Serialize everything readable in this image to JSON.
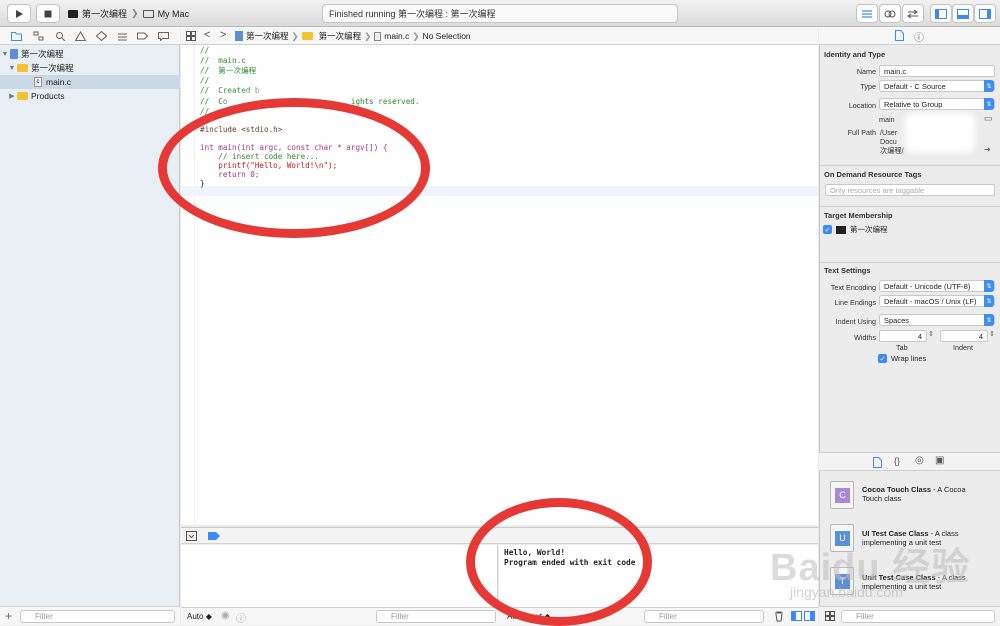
{
  "toolbar": {
    "scheme_target": "第一次编程",
    "scheme_device": "My Mac",
    "activity_text": "Finished running 第一次编程 : 第一次编程"
  },
  "jump_bar": {
    "crumbs": [
      "第一次编程",
      "第一次编程",
      "main.c",
      "No Selection"
    ]
  },
  "navigator": {
    "items": [
      {
        "label": "第一次编程",
        "kind": "project"
      },
      {
        "label": "第一次编程",
        "kind": "folder"
      },
      {
        "label": "main.c",
        "kind": "file",
        "selected": true
      },
      {
        "label": "Products",
        "kind": "folder"
      }
    ],
    "filter_placeholder": "Filter"
  },
  "editor": {
    "lines": [
      "//",
      "//  main.c",
      "//  第一次编程",
      "//",
      "//  Created b",
      "//  Co                           ights reserved.",
      "//",
      "",
      "#include <stdio.h>",
      "",
      "int main(int argc, const char * argv[]) {",
      "    // insert code here...",
      "    printf(\"Hello, World!\\n\");",
      "    return 0;",
      "}"
    ]
  },
  "debug": {
    "auto_label": "Auto",
    "filter_placeholder": "Filter",
    "console_lines": [
      "Hello, World!",
      "Program ended with exit code"
    ],
    "output_label": "All Output",
    "console_filter_placeholder": "Filter"
  },
  "inspector": {
    "identity_title": "Identity and Type",
    "name_label": "Name",
    "name_value": "main.c",
    "type_label": "Type",
    "type_value": "Default - C Source",
    "location_label": "Location",
    "location_value": "Relative to Group",
    "location_file": "main",
    "fullpath_label": "Full Path",
    "fullpath_lines": [
      "/User",
      "Docu",
      "次编程/"
    ],
    "odr_title": "On Demand Resource Tags",
    "odr_placeholder": "Only resources are taggable",
    "target_title": "Target Membership",
    "target_name": "第一次编程",
    "text_title": "Text Settings",
    "encoding_label": "Text Encoding",
    "encoding_value": "Default - Unicode (UTF-8)",
    "lineendings_label": "Line Endings",
    "lineendings_value": "Default - macOS / Unix (LF)",
    "indent_label": "Indent Using",
    "indent_value": "Spaces",
    "widths_label": "Widths",
    "tab_value": "4",
    "indent_width_value": "4",
    "tab_label": "Tab",
    "indent_sub_label": "Indent",
    "wrap_label": "Wrap lines"
  },
  "library": {
    "items": [
      {
        "title": "Cocoa Touch Class",
        "desc1": " - A Cocoa",
        "desc2": "Touch class",
        "letter": "C"
      },
      {
        "title": "UI Test Case Class",
        "desc1": " - A class",
        "desc2": "implementing a unit test",
        "letter": "U"
      },
      {
        "title": "Unit Test Case Class",
        "desc1": " - A class",
        "desc2": "implementing a unit test",
        "letter": "T"
      }
    ],
    "filter_placeholder": "Filter"
  },
  "watermark": "Baidu 经验",
  "watermark_url": "jingyan.baidu.com",
  "colors": {
    "accent": "#3d8af7",
    "annotation": "#e53935",
    "comment": "#2d8a2d",
    "keyword": "#a3367f",
    "string": "#c41a16"
  }
}
